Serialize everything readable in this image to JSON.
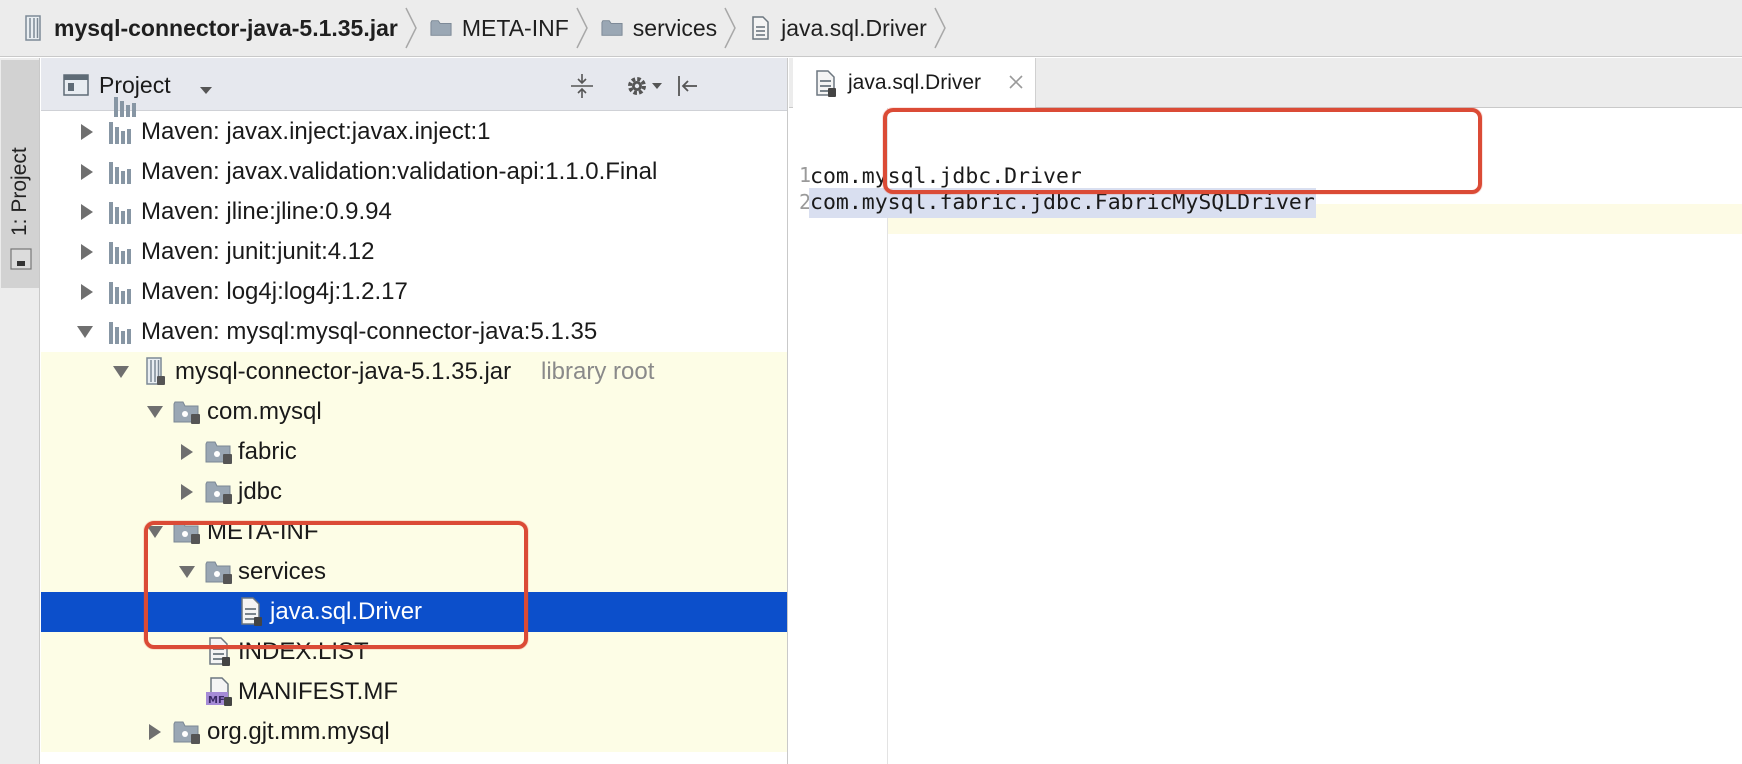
{
  "breadcrumb": [
    {
      "label": "mysql-connector-java-5.1.35.jar",
      "icon": "jar-icon",
      "bold": true
    },
    {
      "label": "META-INF",
      "icon": "folder-icon",
      "bold": false
    },
    {
      "label": "services",
      "icon": "folder-icon",
      "bold": false
    },
    {
      "label": "java.sql.Driver",
      "icon": "text-file-icon",
      "bold": false
    }
  ],
  "tool_stripe": {
    "label": "1: Project"
  },
  "project_panel": {
    "title": "Project",
    "tree": [
      {
        "label": "Maven: javax.inject:javax.inject:1",
        "hint": "",
        "icon": "library-icon",
        "expanded": false
      },
      {
        "label": "Maven: javax.validation:validation-api:1.1.0.Final",
        "hint": "",
        "icon": "library-icon",
        "expanded": false
      },
      {
        "label": "Maven: jline:jline:0.9.94",
        "hint": "",
        "icon": "library-icon",
        "expanded": false
      },
      {
        "label": "Maven: junit:junit:4.12",
        "hint": "",
        "icon": "library-icon",
        "expanded": false
      },
      {
        "label": "Maven: log4j:log4j:1.2.17",
        "hint": "",
        "icon": "library-icon",
        "expanded": false
      },
      {
        "label": "Maven: mysql:mysql-connector-java:5.1.35",
        "hint": "",
        "icon": "library-icon",
        "expanded": true
      },
      {
        "label": "mysql-connector-java-5.1.35.jar",
        "hint": "library root",
        "icon": "jar-icon",
        "expanded": true
      },
      {
        "label": "com.mysql",
        "hint": "",
        "icon": "package-icon",
        "expanded": true
      },
      {
        "label": "fabric",
        "hint": "",
        "icon": "package-icon",
        "expanded": false
      },
      {
        "label": "jdbc",
        "hint": "",
        "icon": "package-icon",
        "expanded": false
      },
      {
        "label": "META-INF",
        "hint": "",
        "icon": "package-icon",
        "expanded": true
      },
      {
        "label": "services",
        "hint": "",
        "icon": "package-icon",
        "expanded": true
      },
      {
        "label": "java.sql.Driver",
        "hint": "",
        "icon": "text-file-icon",
        "expanded": null
      },
      {
        "label": "INDEX.LIST",
        "hint": "",
        "icon": "text-file-icon",
        "expanded": null
      },
      {
        "label": "MANIFEST.MF",
        "hint": "",
        "icon": "manifest-icon",
        "expanded": null
      },
      {
        "label": "org.gjt.mm.mysql",
        "hint": "",
        "icon": "package-icon",
        "expanded": false
      }
    ]
  },
  "editor": {
    "tab": {
      "label": "java.sql.Driver"
    },
    "lines": [
      {
        "number": "1",
        "text": "com.mysql.jdbc.Driver"
      },
      {
        "number": "2",
        "text": "com.mysql.fabric.jdbc.FabricMySQLDriver"
      }
    ]
  },
  "colors": {
    "selection": "#0c4fcb",
    "annotation": "#db4b36",
    "library_root_highlight": "#fdfde6"
  }
}
